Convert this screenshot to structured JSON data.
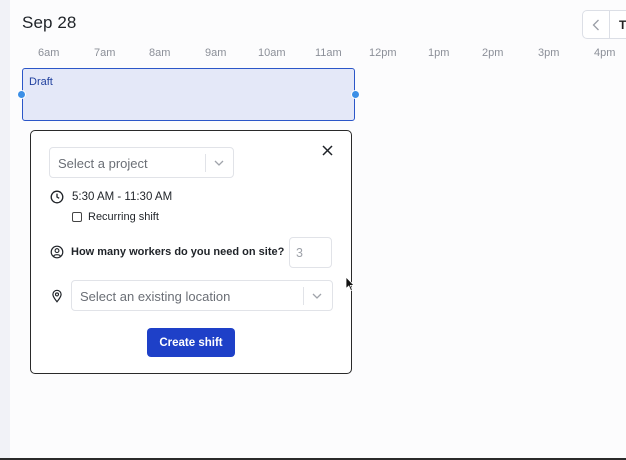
{
  "header": {
    "date_title": "Sep 28",
    "today_label": "T"
  },
  "timeline": {
    "hours": [
      "6am",
      "7am",
      "8am",
      "9am",
      "10am",
      "11am",
      "12pm",
      "1pm",
      "2pm",
      "3pm",
      "4pm"
    ]
  },
  "shift": {
    "label": "Draft"
  },
  "popover": {
    "project_placeholder": "Select a project",
    "time_range": "5:30 AM - 11:30 AM",
    "recurring_label": "Recurring shift",
    "workers_question": "How many workers do you need on site?",
    "workers_value": "3",
    "location_placeholder": "Select an existing location",
    "create_label": "Create shift"
  },
  "icons": {
    "prev": "chevron-left-icon",
    "close": "close-icon",
    "clock": "clock-icon",
    "user": "user-circle-icon",
    "location": "map-pin-icon",
    "dropdown": "chevron-down-icon",
    "cursor": "mouse-pointer-icon"
  },
  "colors": {
    "accent": "#1e40c8",
    "shift_fill": "#e4e8f8",
    "shift_border": "#2b56c8",
    "handle": "#3c8fe6"
  }
}
